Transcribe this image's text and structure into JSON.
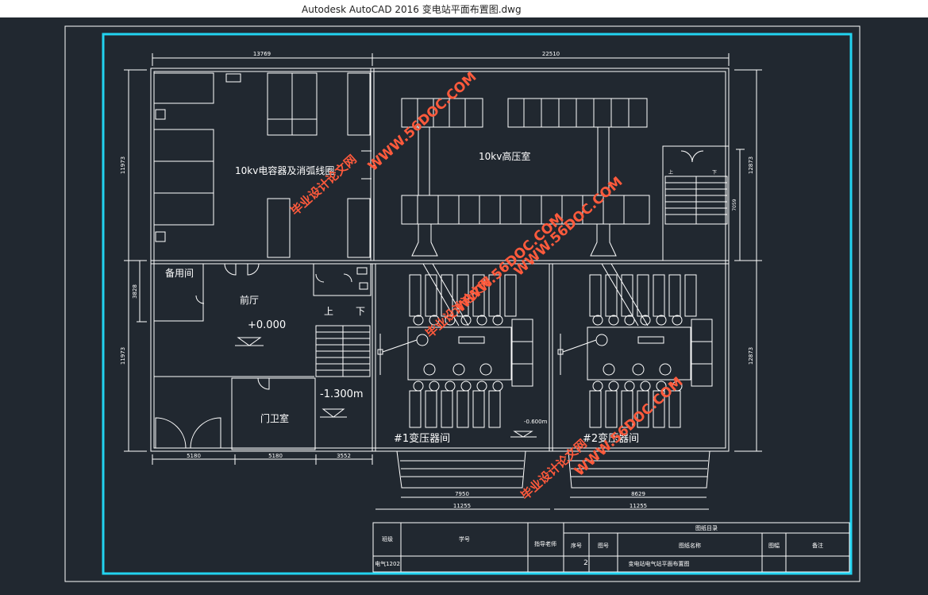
{
  "window": {
    "title": "Autodesk AutoCAD 2016     变电站平面布置图.dwg"
  },
  "dimensions": {
    "top_left": "13769",
    "top_right": "22510",
    "left_upper": "11973",
    "left_mid": "3828",
    "left_lower": "11973",
    "right_upper": "12873",
    "stair_height": "7059",
    "right_lower": "12873",
    "bottom_1": "5180",
    "bottom_2": "5180",
    "bottom_3": "3552",
    "t1_inner": "7950",
    "t1_outer": "11255",
    "t2_inner": "8629",
    "t2_outer": "11255"
  },
  "rooms": {
    "capacitor": "10kv电容器及消弧线圈",
    "hv": "10kv高压室",
    "spare": "备用间",
    "hall": "前厅",
    "hall_level": "+0.000",
    "up": "上",
    "down": "下",
    "basement_level": "-1.300m",
    "guard": "门卫室",
    "t1": "#1变压器间",
    "t2": "#2变压器间",
    "t1_level": "-0.600m",
    "stair_up": "上",
    "stair_down": "下"
  },
  "watermarks": {
    "url": "WWW.56DOC.COM",
    "cn": "毕业设计论文网"
  },
  "titleblock": {
    "header": "图纸目录",
    "class_label": "班级",
    "student_no": "学号",
    "advisor": "指导老师",
    "seq": "序号",
    "sheet_no": "图号",
    "drawing_name": "图纸名称",
    "sheet_size": "图幅",
    "remark": "备注",
    "class_value": "电气1202",
    "seq_value": "2",
    "drawing_value": "变电站电气站平面布置图"
  }
}
